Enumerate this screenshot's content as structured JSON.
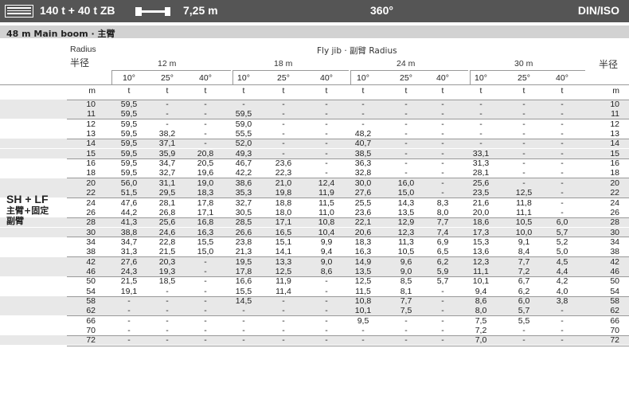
{
  "header": {
    "capacity": "140 t + 40 t ZB",
    "radius_value": "7,25 m",
    "slew": "360°",
    "standard": "DIN/ISO"
  },
  "subheader": {
    "title": "48 m   Main boom · 主臂"
  },
  "table_labels": {
    "radius_en": "Radius",
    "radius_cn": "半径",
    "radius_cn_right": "半径",
    "flyjib": "Fly jib · 副臂 Radius",
    "unit_m": "m",
    "side_label": "SH + LF",
    "side_cn1": "主臂+固定",
    "side_cn2": "副臂"
  },
  "jib_lengths": [
    "12 m",
    "18 m",
    "24 m",
    "30 m"
  ],
  "angles": [
    "10°",
    "25°",
    "40°",
    "10°",
    "25°",
    "40°",
    "10°",
    "25°",
    "40°",
    "10°",
    "25°",
    "40°"
  ],
  "unit_row": [
    "t",
    "t",
    "t",
    "t",
    "t",
    "t",
    "t",
    "t",
    "t",
    "t",
    "t",
    "t"
  ],
  "rows": [
    {
      "r": "10",
      "v": [
        "59,5",
        "-",
        "-",
        "-",
        "-",
        "-",
        "-",
        "-",
        "-",
        "-",
        "-",
        "-"
      ]
    },
    {
      "r": "11",
      "v": [
        "59,5",
        "-",
        "-",
        "59,5",
        "-",
        "-",
        "-",
        "-",
        "-",
        "-",
        "-",
        "-"
      ]
    },
    {
      "r": "12",
      "v": [
        "59,5",
        "-",
        "-",
        "59,0",
        "-",
        "-",
        "-",
        "-",
        "-",
        "-",
        "-",
        "-"
      ]
    },
    {
      "r": "13",
      "v": [
        "59,5",
        "38,2",
        "-",
        "55,5",
        "-",
        "-",
        "48,2",
        "-",
        "-",
        "-",
        "-",
        "-"
      ]
    },
    {
      "r": "14",
      "v": [
        "59,5",
        "37,1",
        "-",
        "52,0",
        "-",
        "-",
        "40,7",
        "-",
        "-",
        "-",
        "-",
        "-"
      ]
    },
    {
      "r": "15",
      "v": [
        "59,5",
        "35,9",
        "20,8",
        "49,3",
        "-",
        "-",
        "38,5",
        "-",
        "-",
        "33,1",
        "-",
        "-"
      ]
    },
    {
      "r": "16",
      "v": [
        "59,5",
        "34,7",
        "20,5",
        "46,7",
        "23,6",
        "-",
        "36,3",
        "-",
        "-",
        "31,3",
        "-",
        "-"
      ]
    },
    {
      "r": "18",
      "v": [
        "59,5",
        "32,7",
        "19,6",
        "42,2",
        "22,3",
        "-",
        "32,8",
        "-",
        "-",
        "28,1",
        "-",
        "-"
      ]
    },
    {
      "r": "20",
      "v": [
        "56,0",
        "31,1",
        "19,0",
        "38,6",
        "21,0",
        "12,4",
        "30,0",
        "16,0",
        "-",
        "25,6",
        "-",
        "-"
      ]
    },
    {
      "r": "22",
      "v": [
        "51,5",
        "29,5",
        "18,3",
        "35,3",
        "19,8",
        "11,9",
        "27,6",
        "15,0",
        "-",
        "23,5",
        "12,5",
        "-"
      ]
    },
    {
      "r": "24",
      "v": [
        "47,6",
        "28,1",
        "17,8",
        "32,7",
        "18,8",
        "11,5",
        "25,5",
        "14,3",
        "8,3",
        "21,6",
        "11,8",
        "-"
      ]
    },
    {
      "r": "26",
      "v": [
        "44,2",
        "26,8",
        "17,1",
        "30,5",
        "18,0",
        "11,0",
        "23,6",
        "13,5",
        "8,0",
        "20,0",
        "11,1",
        "-"
      ]
    },
    {
      "r": "28",
      "v": [
        "41,3",
        "25,6",
        "16,8",
        "28,5",
        "17,1",
        "10,8",
        "22,1",
        "12,9",
        "7,7",
        "18,6",
        "10,5",
        "6,0"
      ]
    },
    {
      "r": "30",
      "v": [
        "38,8",
        "24,6",
        "16,3",
        "26,6",
        "16,5",
        "10,4",
        "20,6",
        "12,3",
        "7,4",
        "17,3",
        "10,0",
        "5,7"
      ]
    },
    {
      "r": "34",
      "v": [
        "34,7",
        "22,8",
        "15,5",
        "23,8",
        "15,1",
        "9,9",
        "18,3",
        "11,3",
        "6,9",
        "15,3",
        "9,1",
        "5,2"
      ]
    },
    {
      "r": "38",
      "v": [
        "31,3",
        "21,5",
        "15,0",
        "21,3",
        "14,1",
        "9,4",
        "16,3",
        "10,5",
        "6,5",
        "13,6",
        "8,4",
        "5,0"
      ]
    },
    {
      "r": "42",
      "v": [
        "27,6",
        "20,3",
        "-",
        "19,5",
        "13,3",
        "9,0",
        "14,9",
        "9,6",
        "6,2",
        "12,3",
        "7,7",
        "4,5"
      ]
    },
    {
      "r": "46",
      "v": [
        "24,3",
        "19,3",
        "-",
        "17,8",
        "12,5",
        "8,6",
        "13,5",
        "9,0",
        "5,9",
        "11,1",
        "7,2",
        "4,4"
      ]
    },
    {
      "r": "50",
      "v": [
        "21,5",
        "18,5",
        "-",
        "16,6",
        "11,9",
        "-",
        "12,5",
        "8,5",
        "5,7",
        "10,1",
        "6,7",
        "4,2"
      ]
    },
    {
      "r": "54",
      "v": [
        "19,1",
        "-",
        "-",
        "15,5",
        "11,4",
        "-",
        "11,5",
        "8,1",
        "-",
        "9,4",
        "6,2",
        "4,0"
      ]
    },
    {
      "r": "58",
      "v": [
        "-",
        "-",
        "-",
        "14,5",
        "-",
        "-",
        "10,8",
        "7,7",
        "-",
        "8,6",
        "6,0",
        "3,8"
      ]
    },
    {
      "r": "62",
      "v": [
        "-",
        "-",
        "-",
        "-",
        "-",
        "-",
        "10,1",
        "7,5",
        "-",
        "8,0",
        "5,7",
        "-"
      ]
    },
    {
      "r": "66",
      "v": [
        "-",
        "-",
        "-",
        "-",
        "-",
        "-",
        "9,5",
        "-",
        "-",
        "7,5",
        "5,5",
        "-"
      ]
    },
    {
      "r": "70",
      "v": [
        "-",
        "-",
        "-",
        "-",
        "-",
        "-",
        "-",
        "-",
        "-",
        "7,2",
        "-",
        "-"
      ]
    },
    {
      "r": "72",
      "v": [
        "-",
        "-",
        "-",
        "-",
        "-",
        "-",
        "-",
        "-",
        "-",
        "7,0",
        "-",
        "-"
      ]
    }
  ]
}
